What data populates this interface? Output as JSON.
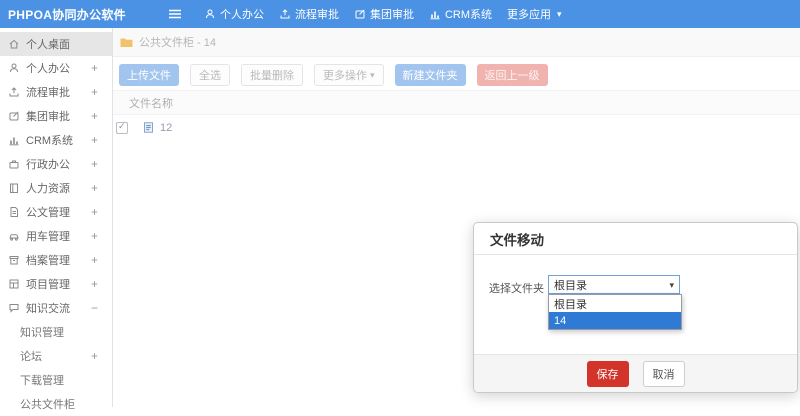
{
  "topbar": {
    "logo": "PHPOA协同办公软件",
    "items": [
      {
        "label": "个人办公",
        "icon": "user-icon"
      },
      {
        "label": "流程审批",
        "icon": "upload-icon"
      },
      {
        "label": "集团审批",
        "icon": "edit-icon"
      },
      {
        "label": "CRM系统",
        "icon": "chart-icon"
      },
      {
        "label": "更多应用",
        "icon": "caret-down-icon"
      }
    ]
  },
  "sidebar": {
    "items": [
      {
        "label": "个人桌面",
        "icon": "home-icon",
        "expand": "",
        "active": true
      },
      {
        "label": "个人办公",
        "icon": "user-icon",
        "expand": "+"
      },
      {
        "label": "流程审批",
        "icon": "upload-icon",
        "expand": "+"
      },
      {
        "label": "集团审批",
        "icon": "edit-icon",
        "expand": "+"
      },
      {
        "label": "CRM系统",
        "icon": "chart-icon",
        "expand": "+"
      },
      {
        "label": "行政办公",
        "icon": "briefcase-icon",
        "expand": "+"
      },
      {
        "label": "人力资源",
        "icon": "book-icon",
        "expand": "+"
      },
      {
        "label": "公文管理",
        "icon": "doc-icon",
        "expand": "+"
      },
      {
        "label": "用车管理",
        "icon": "car-icon",
        "expand": "+"
      },
      {
        "label": "档案管理",
        "icon": "archive-icon",
        "expand": "+"
      },
      {
        "label": "项目管理",
        "icon": "project-icon",
        "expand": "+"
      },
      {
        "label": "知识交流",
        "icon": "chat-icon",
        "expand": "−"
      },
      {
        "label": "知识管理",
        "sub": true,
        "expand": ""
      },
      {
        "label": "论坛",
        "sub": true,
        "expand": "+"
      },
      {
        "label": "下载管理",
        "sub": true,
        "expand": ""
      },
      {
        "label": "公共文件柜",
        "sub": true,
        "expand": ""
      }
    ]
  },
  "main": {
    "breadcrumb": {
      "icon": "folder-icon",
      "text": "公共文件柜 - 14"
    },
    "toolbar": [
      {
        "label": "上传文件",
        "style": "primary"
      },
      {
        "label": "全选",
        "style": "default"
      },
      {
        "label": "批量删除",
        "style": "default"
      },
      {
        "label": "更多操作",
        "style": "default",
        "caret": "▾"
      },
      {
        "label": "新建文件夹",
        "style": "primary"
      },
      {
        "label": "返回上一级",
        "style": "danger"
      }
    ],
    "table": {
      "name_header": "文件名称",
      "rows": [
        {
          "checked": true,
          "icon": "file-icon",
          "name": "12"
        }
      ]
    }
  },
  "modal": {
    "title": "文件移动",
    "field_label": "选择文件夹",
    "select_value": "根目录",
    "options": [
      {
        "label": "根目录",
        "selected": false
      },
      {
        "label": "14",
        "selected": true
      }
    ],
    "save_label": "保存",
    "cancel_label": "取消"
  },
  "colors": {
    "topbar_blue": "#4b92e4",
    "primary_button": "#a2c5ef",
    "danger_button": "#f1b3af",
    "save_button": "#d2342b",
    "option_highlight": "#2e7ad4",
    "folder_icon": "#f0c36b",
    "sidebar_active": "#e6e6e6"
  }
}
